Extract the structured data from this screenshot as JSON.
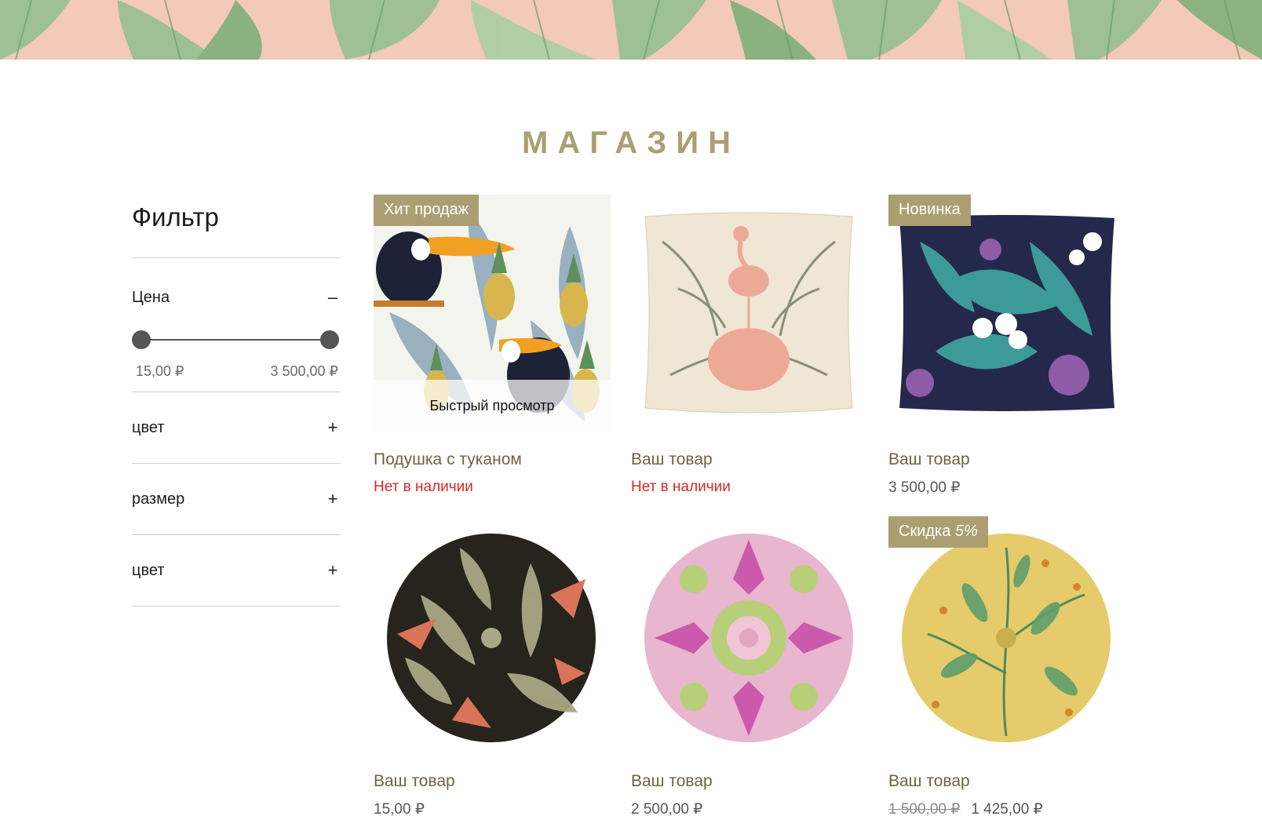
{
  "banner": {
    "pattern": "tropical-leaves",
    "bg_color": "#f3c9b7",
    "leaf_color": "#8fbf8a"
  },
  "page": {
    "title": "МАГАЗИН",
    "accent_color": "#ab9f72"
  },
  "filter": {
    "title": "Фильтр",
    "price": {
      "label": "Цена",
      "toggle": "–",
      "min_label": "15,00 ₽",
      "max_label": "3 500,00 ₽",
      "range_fraction": [
        0,
        1
      ]
    },
    "sections": [
      {
        "label": "цвет",
        "toggle": "+"
      },
      {
        "label": "размер",
        "toggle": "+"
      },
      {
        "label": "цвет",
        "toggle": "+"
      }
    ]
  },
  "products": [
    {
      "name": "Подушка с туканом",
      "ribbon": "Хит продаж",
      "status": "Нет в наличии",
      "quick_view": "Быстрый просмотр",
      "image": "toucan-pineapple-pattern"
    },
    {
      "name": "Ваш товар",
      "status": "Нет в наличии",
      "image": "flamingo-square-cushion"
    },
    {
      "name": "Ваш товар",
      "ribbon": "Новинка",
      "price": "3 500,00 ₽",
      "image": "orchid-navy-square-cushion"
    },
    {
      "name": "Ваш товар",
      "price": "15,00 ₽",
      "image": "black-floral-round-cushion"
    },
    {
      "name": "Ваш товар",
      "price": "2 500,00 ₽",
      "image": "pink-ikat-round-cushion"
    },
    {
      "name": "Ваш товар",
      "ribbon_main": "Скидка",
      "ribbon_pct": "5%",
      "old_price": "1 500,00 ₽",
      "price": "1 425,00 ₽",
      "image": "yellow-botanical-round-cushion"
    }
  ]
}
